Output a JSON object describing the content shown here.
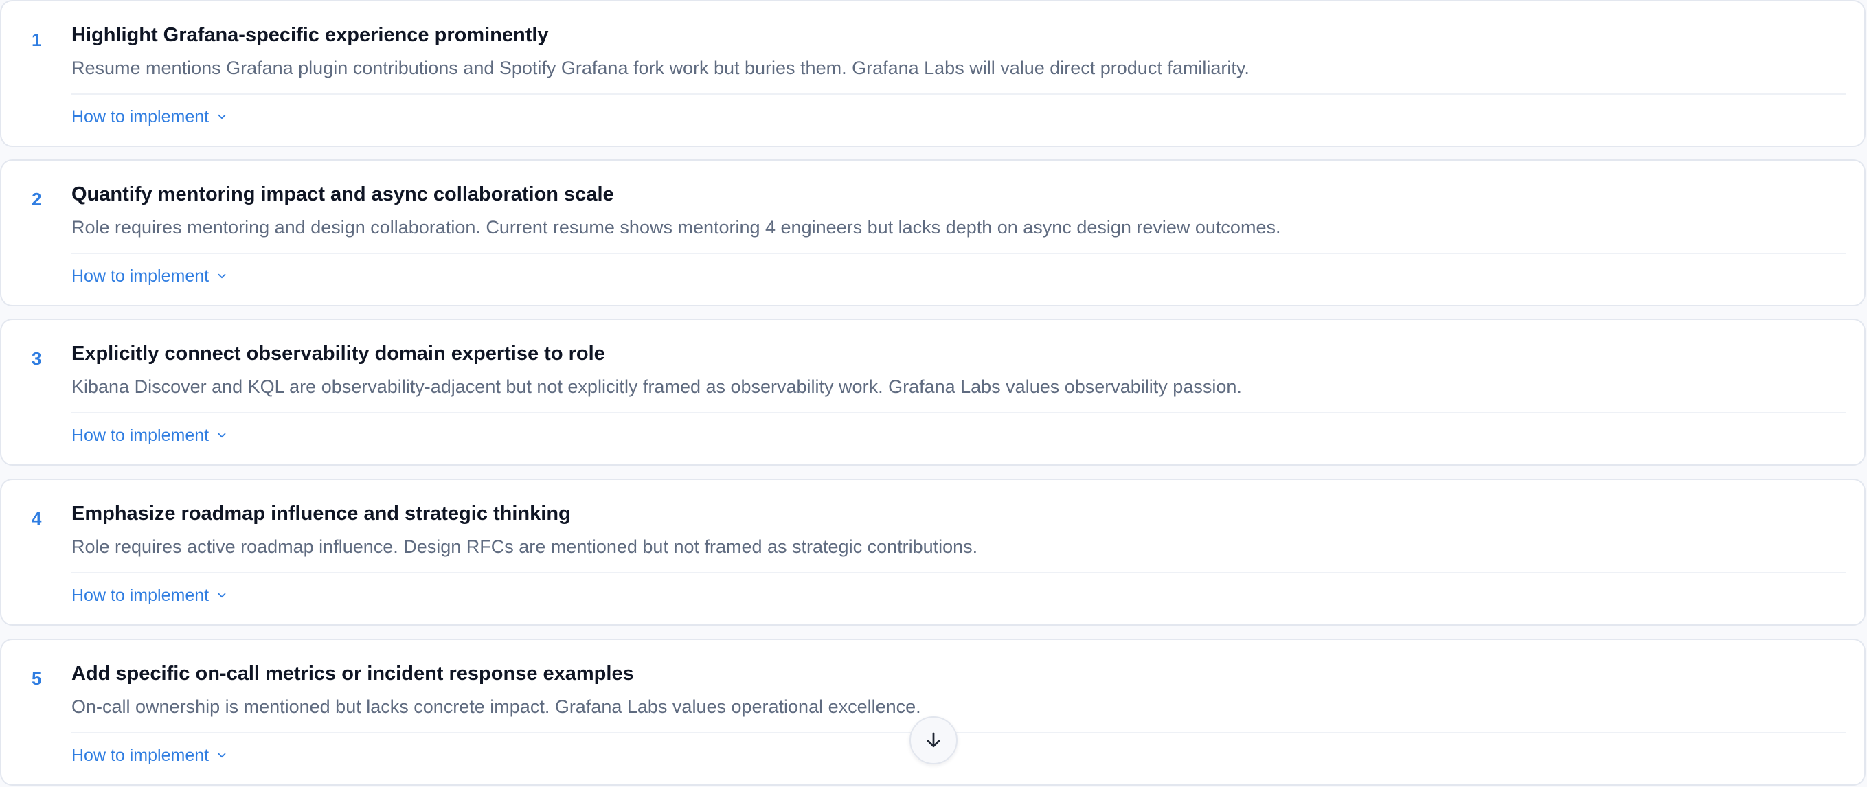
{
  "suggestions": [
    {
      "number": "1",
      "title": "Highlight Grafana-specific experience prominently",
      "description": "Resume mentions Grafana plugin contributions and Spotify Grafana fork work but buries them. Grafana Labs will value direct product familiarity.",
      "action_label": "How to implement"
    },
    {
      "number": "2",
      "title": "Quantify mentoring impact and async collaboration scale",
      "description": "Role requires mentoring and design collaboration. Current resume shows mentoring 4 engineers but lacks depth on async design review outcomes.",
      "action_label": "How to implement"
    },
    {
      "number": "3",
      "title": "Explicitly connect observability domain expertise to role",
      "description": "Kibana Discover and KQL are observability-adjacent but not explicitly framed as observability work. Grafana Labs values observability passion.",
      "action_label": "How to implement"
    },
    {
      "number": "4",
      "title": "Emphasize roadmap influence and strategic thinking",
      "description": "Role requires active roadmap influence. Design RFCs are mentioned but not framed as strategic contributions.",
      "action_label": "How to implement"
    },
    {
      "number": "5",
      "title": "Add specific on-call metrics or incident response examples",
      "description": "On-call ownership is mentioned but lacks concrete impact. Grafana Labs values operational excellence.",
      "action_label": "How to implement"
    }
  ],
  "icons": {
    "expand": "chevron-down-icon",
    "scroll": "arrow-down-icon"
  },
  "colors": {
    "accent": "#2f7de1",
    "title": "#0f1524",
    "description": "#5f6b80",
    "card_border": "#e3e7ef",
    "background": "#f8f9fc"
  }
}
